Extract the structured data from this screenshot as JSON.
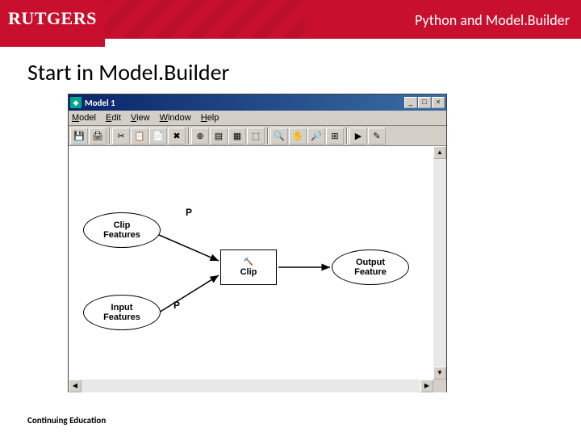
{
  "header": {
    "logo": "RUTGERS",
    "title": "Python and Model.Builder"
  },
  "slide": {
    "title": "Start in Model.Builder"
  },
  "footer": {
    "text": "Continuing Education"
  },
  "app": {
    "window_title": "Model 1",
    "menus": [
      "Model",
      "Edit",
      "View",
      "Window",
      "Help"
    ],
    "toolbar_icons": {
      "save": "💾",
      "print": "🖨",
      "cut": "✂",
      "copy": "📋",
      "paste": "📄",
      "delete": "✖",
      "add_data": "⊕",
      "connect1": "▤",
      "connect2": "▦",
      "select": "⬚",
      "zoom_in": "🔍",
      "pan": "✋",
      "zoom_out": "🔎",
      "full_extent": "⊞",
      "pointer": "▶",
      "tool": "✎"
    },
    "window_buttons": {
      "min": "_",
      "max": "□",
      "close": "×"
    }
  },
  "diagram": {
    "p1_label": "P",
    "p2_label": "P",
    "clip_features": "Clip\nFeatures",
    "input_features": "Input\nFeatures",
    "clip": "Clip",
    "output_feature": "Output\nFeature"
  }
}
